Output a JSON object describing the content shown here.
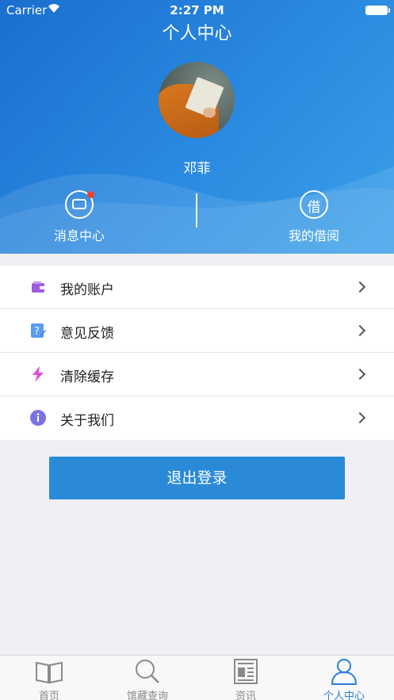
{
  "status_bar": {
    "carrier": "Carrier",
    "time": "2:27 PM"
  },
  "header": {
    "title": "个人中心",
    "username": "邓菲",
    "actions": [
      {
        "label": "消息中心",
        "icon": "message-icon",
        "has_unread_dot": true
      },
      {
        "label": "我的借阅",
        "icon": "borrow-icon",
        "glyph": "借"
      }
    ]
  },
  "menu": [
    {
      "label": "我的账户",
      "icon": "wallet-icon",
      "color": "#a05ce0"
    },
    {
      "label": "意见反馈",
      "icon": "feedback-icon",
      "color": "#5b9cf0"
    },
    {
      "label": "清除缓存",
      "icon": "lightning-icon",
      "color": "#e04fd6"
    },
    {
      "label": "关于我们",
      "icon": "info-icon",
      "color": "#7a73e6"
    }
  ],
  "logout_label": "退出登录",
  "tabs": [
    {
      "label": "首页",
      "icon": "book-icon",
      "active": false
    },
    {
      "label": "馆藏查询",
      "icon": "search-icon",
      "active": false
    },
    {
      "label": "资讯",
      "icon": "news-icon",
      "active": false
    },
    {
      "label": "个人中心",
      "icon": "user-icon",
      "active": true
    }
  ],
  "colors": {
    "primary": "#2a8ad8",
    "active_tab": "#2a7fd8",
    "unread_dot": "#f2412c"
  }
}
